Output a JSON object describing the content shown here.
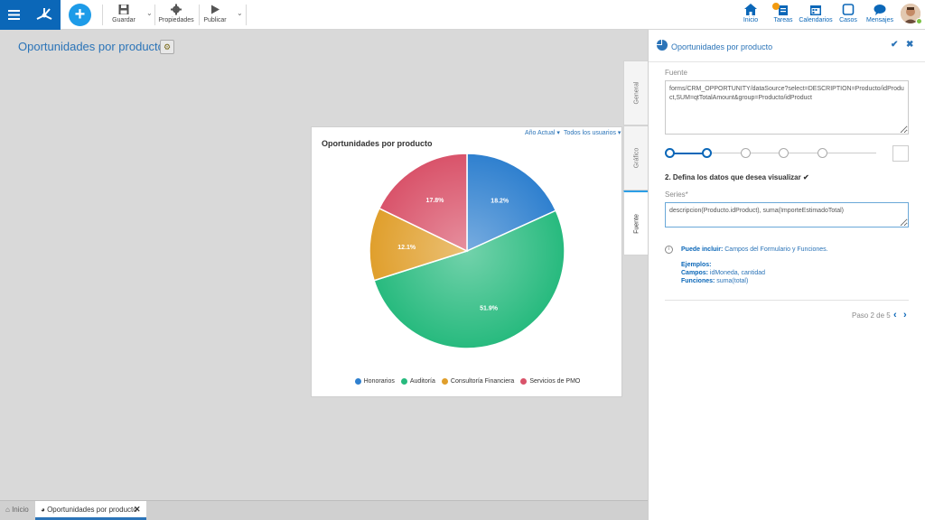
{
  "toolbar": {
    "save_label": "Guardar",
    "properties_label": "Propiedades",
    "publish_label": "Publicar"
  },
  "topnav": {
    "home_label": "Inicio",
    "tasks_label": "Tareas",
    "calendars_label": "Calendarios",
    "cases_label": "Casos",
    "messages_label": "Mensajes"
  },
  "page": {
    "title": "Oportunidades por producto"
  },
  "chart_card": {
    "filter_year": "Año Actual",
    "filter_users": "Todos los usuarios"
  },
  "chart_data": {
    "type": "pie",
    "title": "Oportunidades por producto",
    "slices": [
      {
        "label": "Honorarios",
        "value": 18.2,
        "value_label": "18.2%",
        "color": "#2f80cf"
      },
      {
        "label": "Auditoría",
        "value": 51.9,
        "value_label": "51.9%",
        "color": "#27ba7e"
      },
      {
        "label": "Consultoría Financiera",
        "value": 12.1,
        "value_label": "12.1%",
        "color": "#e09f2c"
      },
      {
        "label": "Servicios de PMO",
        "value": 17.8,
        "value_label": "17.8%",
        "color": "#d9536a"
      }
    ],
    "legend_position": "bottom"
  },
  "taskbar": {
    "home_label": "Inicio",
    "tab_label": "Oportunidades por producto"
  },
  "side_tabs": {
    "general": "General",
    "grafico": "Gráfico",
    "fuente": "Fuente"
  },
  "panel": {
    "title": "Oportunidades por producto",
    "source_label": "Fuente",
    "source_value": "forms/CRM_OPPORTUNITY/dataSource?select=DESCRIPTION=Producto/idProduct,SUM=qtTotalAmount&group=Producto/idProduct",
    "step_heading": "2. Defina los datos que desea visualizar ✔",
    "series_label": "Series*",
    "series_value": "descripcion(Producto.idProduct), suma(ImporteEstimadoTotal)",
    "can_include_label": "Puede incluir:",
    "can_include_value": "Campos del Formulario y Funciones.",
    "examples_label": "Ejemplos:",
    "fields_label": "Campos:",
    "fields_value": "idMoneda, cantidad",
    "functions_label": "Funciones:",
    "functions_value": "suma(total)",
    "pager_text": "Paso 2 de 5"
  },
  "colors": {
    "brand_blue": "#0b67b8",
    "accent_blue": "#2b74b8",
    "add_button": "#1d9be8"
  }
}
